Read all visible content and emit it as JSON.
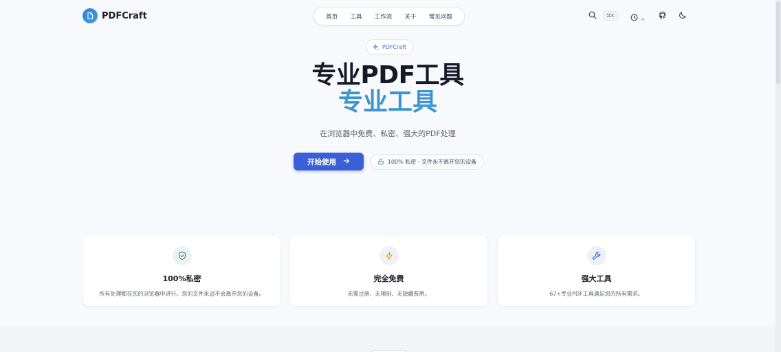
{
  "brand": {
    "name": "PDFCraft"
  },
  "nav": {
    "items": [
      {
        "label": "首页"
      },
      {
        "label": "工具"
      },
      {
        "label": "工作流"
      },
      {
        "label": "关于"
      },
      {
        "label": "常见问题"
      }
    ]
  },
  "header": {
    "search_shortcut": "⌘K",
    "icons": [
      "search-icon",
      "history-icon",
      "github-icon",
      "moon-icon"
    ]
  },
  "hero": {
    "badge": "PDFCraft",
    "title": "专业PDF工具",
    "subtitle": "专业工具",
    "description": "在浏览器中免费、私密、强大的PDF处理",
    "cta_label": "开始使用",
    "privacy_note": "100% 私密 - 文件永不离开您的设备"
  },
  "features": [
    {
      "icon": "shield-check-icon",
      "title": "100%私密",
      "description": "所有处理都在您的浏览器中进行。您的文件永远不会离开您的设备。",
      "icon_color": "#2f9a5a"
    },
    {
      "icon": "lightning-icon",
      "title": "完全免费",
      "description": "无需注册、无限制、无隐藏费用。",
      "icon_color": "#e2a21a"
    },
    {
      "icon": "wrench-icon",
      "title": "强大工具",
      "description": "67+专业PDF工具满足您的所有需求。",
      "icon_color": "#3b6fd0"
    }
  ],
  "colors": {
    "accent": "#3b5fd6",
    "subtitle": "#3b95cf",
    "background": "#f8f9fc"
  }
}
